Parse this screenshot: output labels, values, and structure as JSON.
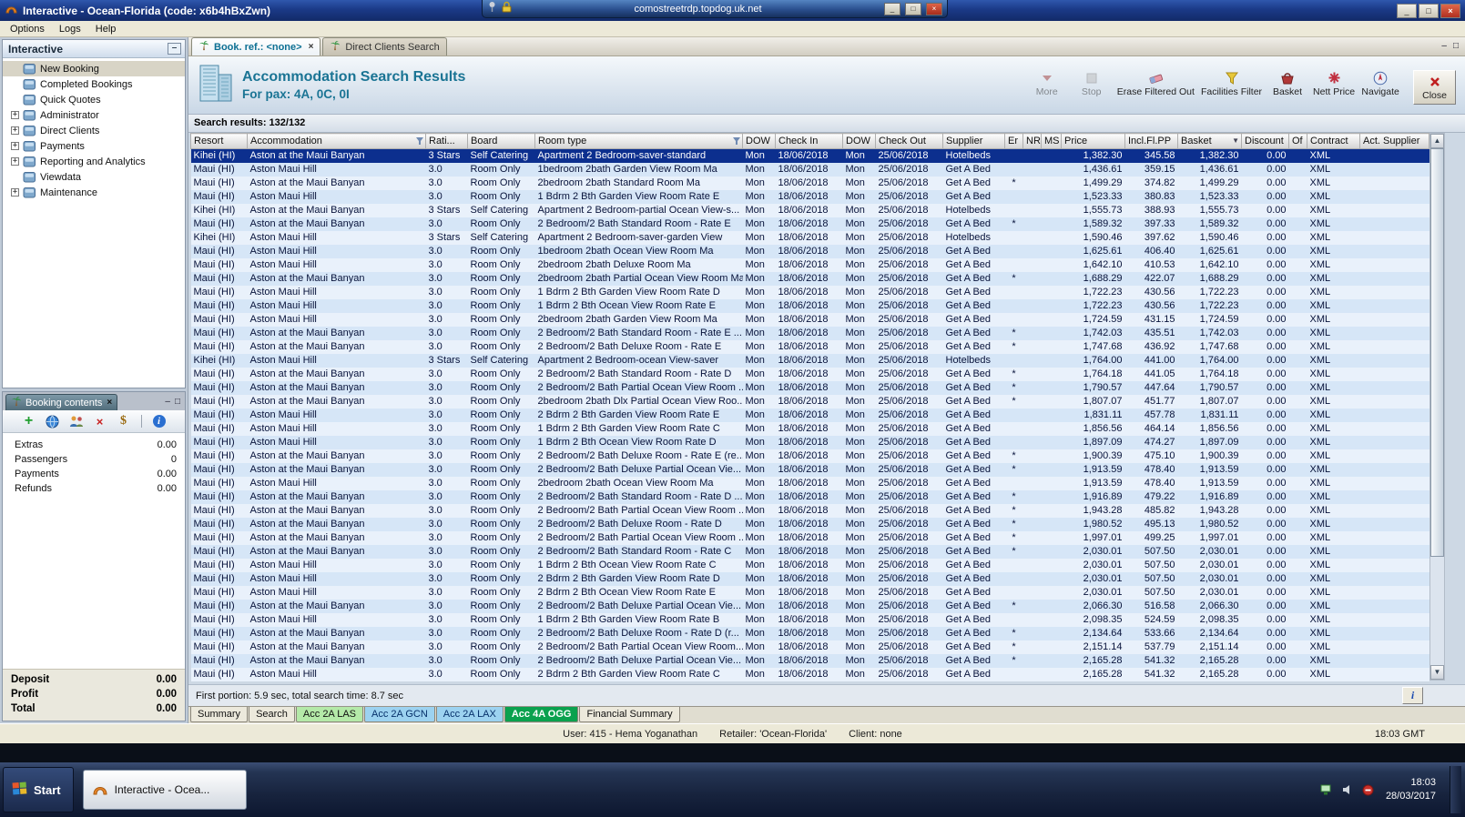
{
  "rdp_bar": {
    "host": "comostreetrdp.topdog.uk.net"
  },
  "window": {
    "title": "Interactive - Ocean-Florida (code: x6b4hBxZwn)"
  },
  "menu": {
    "items": [
      "Options",
      "Logs",
      "Help"
    ]
  },
  "sidebar": {
    "title": "Interactive",
    "items": [
      {
        "label": "New Booking",
        "expandable": false,
        "selected": true
      },
      {
        "label": "Completed Bookings",
        "expandable": false,
        "selected": false
      },
      {
        "label": "Quick Quotes",
        "expandable": false,
        "selected": false
      },
      {
        "label": "Administrator",
        "expandable": true,
        "selected": false
      },
      {
        "label": "Direct Clients",
        "expandable": true,
        "selected": false
      },
      {
        "label": "Payments",
        "expandable": true,
        "selected": false
      },
      {
        "label": "Reporting and Analytics",
        "expandable": true,
        "selected": false
      },
      {
        "label": "Viewdata",
        "expandable": false,
        "selected": false
      },
      {
        "label": "Maintenance",
        "expandable": true,
        "selected": false
      }
    ]
  },
  "booking_contents": {
    "title": "Booking contents",
    "rows": [
      {
        "label": "Extras",
        "value": "0.00"
      },
      {
        "label": "Passengers",
        "value": "0"
      },
      {
        "label": "Payments",
        "value": "0.00"
      },
      {
        "label": "Refunds",
        "value": "0.00"
      }
    ],
    "totals": [
      {
        "label": "Deposit",
        "value": "0.00"
      },
      {
        "label": "Profit",
        "value": "0.00"
      },
      {
        "label": "Total",
        "value": "0.00"
      }
    ]
  },
  "doc_tabs": [
    {
      "label": "Book. ref.: <none>",
      "active": true,
      "closable": true
    },
    {
      "label": "Direct Clients Search",
      "active": false,
      "closable": false
    }
  ],
  "header": {
    "title": "Accommodation Search Results",
    "subtitle": "For pax: 4A, 0C, 0I"
  },
  "toolbar": {
    "buttons": [
      {
        "label": "More",
        "icon": "more",
        "disabled": true,
        "raised": false
      },
      {
        "label": "Stop",
        "icon": "stop",
        "disabled": true,
        "raised": false
      },
      {
        "label": "Erase Filtered Out",
        "icon": "eraser",
        "disabled": false,
        "raised": false
      },
      {
        "label": "Facilities Filter",
        "icon": "filter",
        "disabled": false,
        "raised": false
      },
      {
        "label": "Basket",
        "icon": "basket",
        "disabled": false,
        "raised": false
      },
      {
        "label": "Nett Price",
        "icon": "nett",
        "disabled": false,
        "raised": false
      },
      {
        "label": "Navigate",
        "icon": "navigate",
        "disabled": false,
        "raised": false
      },
      {
        "label": "Close",
        "icon": "close",
        "disabled": false,
        "raised": true
      }
    ]
  },
  "results": {
    "summary_label": "Search results: 132/132",
    "columns": [
      {
        "label": "Resort"
      },
      {
        "label": "Accommodation",
        "filter": true
      },
      {
        "label": "Rati..."
      },
      {
        "label": "Board"
      },
      {
        "label": "Room type",
        "filter": true
      },
      {
        "label": "DOW"
      },
      {
        "label": "Check In"
      },
      {
        "label": "DOW"
      },
      {
        "label": "Check Out"
      },
      {
        "label": "Supplier"
      },
      {
        "label": "Er"
      },
      {
        "label": "NR"
      },
      {
        "label": "MS"
      },
      {
        "label": "Price"
      },
      {
        "label": "Incl.Fl.PP"
      },
      {
        "label": "Basket",
        "sort": true
      },
      {
        "label": "Discount"
      },
      {
        "label": "Of"
      },
      {
        "label": "Contract"
      },
      {
        "label": "Act. Supplier"
      }
    ],
    "row_defaults": {
      "dow": "Mon",
      "check_in": "18/06/2018",
      "check_out": "25/06/2018",
      "discount": "0.00",
      "contract": "XML"
    },
    "selected_row": 0,
    "rows": [
      [
        "Kihei (HI)",
        "Aston at the Maui Banyan",
        "3 Stars",
        "Self Catering",
        "Apartment 2 Bedroom-saver-standard",
        "Hotelbeds",
        "",
        "1,382.30",
        "345.58",
        "1,382.30"
      ],
      [
        "Maui (HI)",
        "Aston Maui Hill",
        "3.0",
        "Room Only",
        "1bedroom 2bath Garden View Room Ma",
        "Get A Bed",
        "",
        "1,436.61",
        "359.15",
        "1,436.61"
      ],
      [
        "Maui (HI)",
        "Aston at the Maui Banyan",
        "3.0",
        "Room Only",
        "2bedroom 2bath Standard Room Ma",
        "Get A Bed",
        "*",
        "1,499.29",
        "374.82",
        "1,499.29"
      ],
      [
        "Maui (HI)",
        "Aston Maui Hill",
        "3.0",
        "Room Only",
        "1 Bdrm 2 Bth Garden View Room Rate E",
        "Get A Bed",
        "",
        "1,523.33",
        "380.83",
        "1,523.33"
      ],
      [
        "Kihei (HI)",
        "Aston at the Maui Banyan",
        "3 Stars",
        "Self Catering",
        "Apartment 2 Bedroom-partial Ocean View-s...",
        "Hotelbeds",
        "",
        "1,555.73",
        "388.93",
        "1,555.73"
      ],
      [
        "Maui (HI)",
        "Aston at the Maui Banyan",
        "3.0",
        "Room Only",
        "2 Bedroom/2 Bath Standard Room - Rate E",
        "Get A Bed",
        "*",
        "1,589.32",
        "397.33",
        "1,589.32"
      ],
      [
        "Kihei (HI)",
        "Aston Maui Hill",
        "3 Stars",
        "Self Catering",
        "Apartment 2 Bedroom-saver-garden View",
        "Hotelbeds",
        "",
        "1,590.46",
        "397.62",
        "1,590.46"
      ],
      [
        "Maui (HI)",
        "Aston Maui Hill",
        "3.0",
        "Room Only",
        "1bedroom 2bath Ocean View Room Ma",
        "Get A Bed",
        "",
        "1,625.61",
        "406.40",
        "1,625.61"
      ],
      [
        "Maui (HI)",
        "Aston Maui Hill",
        "3.0",
        "Room Only",
        "2bedroom 2bath Deluxe Room Ma",
        "Get A Bed",
        "",
        "1,642.10",
        "410.53",
        "1,642.10"
      ],
      [
        "Maui (HI)",
        "Aston at the Maui Banyan",
        "3.0",
        "Room Only",
        "2bedroom 2bath Partial Ocean View Room Ma",
        "Get A Bed",
        "*",
        "1,688.29",
        "422.07",
        "1,688.29"
      ],
      [
        "Maui (HI)",
        "Aston Maui Hill",
        "3.0",
        "Room Only",
        "1 Bdrm 2 Bth Garden View Room Rate D",
        "Get A Bed",
        "",
        "1,722.23",
        "430.56",
        "1,722.23"
      ],
      [
        "Maui (HI)",
        "Aston Maui Hill",
        "3.0",
        "Room Only",
        "1 Bdrm 2 Bth Ocean View Room Rate E",
        "Get A Bed",
        "",
        "1,722.23",
        "430.56",
        "1,722.23"
      ],
      [
        "Maui (HI)",
        "Aston Maui Hill",
        "3.0",
        "Room Only",
        "2bedroom 2bath Garden View Room Ma",
        "Get A Bed",
        "",
        "1,724.59",
        "431.15",
        "1,724.59"
      ],
      [
        "Maui (HI)",
        "Aston at the Maui Banyan",
        "3.0",
        "Room Only",
        "2 Bedroom/2 Bath Standard Room - Rate E ...",
        "Get A Bed",
        "*",
        "1,742.03",
        "435.51",
        "1,742.03"
      ],
      [
        "Maui (HI)",
        "Aston at the Maui Banyan",
        "3.0",
        "Room Only",
        "2 Bedroom/2 Bath Deluxe Room - Rate E",
        "Get A Bed",
        "*",
        "1,747.68",
        "436.92",
        "1,747.68"
      ],
      [
        "Kihei (HI)",
        "Aston Maui Hill",
        "3 Stars",
        "Self Catering",
        "Apartment 2 Bedroom-ocean View-saver",
        "Hotelbeds",
        "",
        "1,764.00",
        "441.00",
        "1,764.00"
      ],
      [
        "Maui (HI)",
        "Aston at the Maui Banyan",
        "3.0",
        "Room Only",
        "2 Bedroom/2 Bath Standard Room - Rate D",
        "Get A Bed",
        "*",
        "1,764.18",
        "441.05",
        "1,764.18"
      ],
      [
        "Maui (HI)",
        "Aston at the Maui Banyan",
        "3.0",
        "Room Only",
        "2 Bedroom/2 Bath Partial Ocean View Room ...",
        "Get A Bed",
        "*",
        "1,790.57",
        "447.64",
        "1,790.57"
      ],
      [
        "Maui (HI)",
        "Aston at the Maui Banyan",
        "3.0",
        "Room Only",
        "2bedroom 2bath Dlx Partial Ocean View Roo...",
        "Get A Bed",
        "*",
        "1,807.07",
        "451.77",
        "1,807.07"
      ],
      [
        "Maui (HI)",
        "Aston Maui Hill",
        "3.0",
        "Room Only",
        "2 Bdrm 2 Bth Garden View Room Rate E",
        "Get A Bed",
        "",
        "1,831.11",
        "457.78",
        "1,831.11"
      ],
      [
        "Maui (HI)",
        "Aston Maui Hill",
        "3.0",
        "Room Only",
        "1 Bdrm 2 Bth Garden View Room Rate C",
        "Get A Bed",
        "",
        "1,856.56",
        "464.14",
        "1,856.56"
      ],
      [
        "Maui (HI)",
        "Aston Maui Hill",
        "3.0",
        "Room Only",
        "1 Bdrm 2 Bth Ocean View Room Rate D",
        "Get A Bed",
        "",
        "1,897.09",
        "474.27",
        "1,897.09"
      ],
      [
        "Maui (HI)",
        "Aston at the Maui Banyan",
        "3.0",
        "Room Only",
        "2 Bedroom/2 Bath Deluxe Room - Rate E (re...",
        "Get A Bed",
        "*",
        "1,900.39",
        "475.10",
        "1,900.39"
      ],
      [
        "Maui (HI)",
        "Aston at the Maui Banyan",
        "3.0",
        "Room Only",
        "2 Bedroom/2 Bath Deluxe Partial Ocean Vie...",
        "Get A Bed",
        "*",
        "1,913.59",
        "478.40",
        "1,913.59"
      ],
      [
        "Maui (HI)",
        "Aston Maui Hill",
        "3.0",
        "Room Only",
        "2bedroom 2bath Ocean View Room Ma",
        "Get A Bed",
        "",
        "1,913.59",
        "478.40",
        "1,913.59"
      ],
      [
        "Maui (HI)",
        "Aston at the Maui Banyan",
        "3.0",
        "Room Only",
        "2 Bedroom/2 Bath Standard Room - Rate D ...",
        "Get A Bed",
        "*",
        "1,916.89",
        "479.22",
        "1,916.89"
      ],
      [
        "Maui (HI)",
        "Aston at the Maui Banyan",
        "3.0",
        "Room Only",
        "2 Bedroom/2 Bath Partial Ocean View Room ...",
        "Get A Bed",
        "*",
        "1,943.28",
        "485.82",
        "1,943.28"
      ],
      [
        "Maui (HI)",
        "Aston at the Maui Banyan",
        "3.0",
        "Room Only",
        "2 Bedroom/2 Bath Deluxe Room - Rate D",
        "Get A Bed",
        "*",
        "1,980.52",
        "495.13",
        "1,980.52"
      ],
      [
        "Maui (HI)",
        "Aston at the Maui Banyan",
        "3.0",
        "Room Only",
        "2 Bedroom/2 Bath Partial Ocean View Room ...",
        "Get A Bed",
        "*",
        "1,997.01",
        "499.25",
        "1,997.01"
      ],
      [
        "Maui (HI)",
        "Aston at the Maui Banyan",
        "3.0",
        "Room Only",
        "2 Bedroom/2 Bath Standard Room - Rate C",
        "Get A Bed",
        "*",
        "2,030.01",
        "507.50",
        "2,030.01"
      ],
      [
        "Maui (HI)",
        "Aston Maui Hill",
        "3.0",
        "Room Only",
        "1 Bdrm 2 Bth Ocean View Room Rate C",
        "Get A Bed",
        "",
        "2,030.01",
        "507.50",
        "2,030.01"
      ],
      [
        "Maui (HI)",
        "Aston Maui Hill",
        "3.0",
        "Room Only",
        "2 Bdrm 2 Bth Garden View Room Rate D",
        "Get A Bed",
        "",
        "2,030.01",
        "507.50",
        "2,030.01"
      ],
      [
        "Maui (HI)",
        "Aston Maui Hill",
        "3.0",
        "Room Only",
        "2 Bdrm 2 Bth Ocean View Room Rate E",
        "Get A Bed",
        "",
        "2,030.01",
        "507.50",
        "2,030.01"
      ],
      [
        "Maui (HI)",
        "Aston at the Maui Banyan",
        "3.0",
        "Room Only",
        "2 Bedroom/2 Bath Deluxe Partial Ocean Vie...",
        "Get A Bed",
        "*",
        "2,066.30",
        "516.58",
        "2,066.30"
      ],
      [
        "Maui (HI)",
        "Aston Maui Hill",
        "3.0",
        "Room Only",
        "1 Bdrm 2 Bth Garden View Room Rate B",
        "Get A Bed",
        "",
        "2,098.35",
        "524.59",
        "2,098.35"
      ],
      [
        "Maui (HI)",
        "Aston at the Maui Banyan",
        "3.0",
        "Room Only",
        "2 Bedroom/2 Bath Deluxe Room - Rate D (r...",
        "Get A Bed",
        "*",
        "2,134.64",
        "533.66",
        "2,134.64"
      ],
      [
        "Maui (HI)",
        "Aston at the Maui Banyan",
        "3.0",
        "Room Only",
        "2 Bedroom/2 Bath Partial Ocean View Room...",
        "Get A Bed",
        "*",
        "2,151.14",
        "537.79",
        "2,151.14"
      ],
      [
        "Maui (HI)",
        "Aston at the Maui Banyan",
        "3.0",
        "Room Only",
        "2 Bedroom/2 Bath Deluxe Partial Ocean Vie...",
        "Get A Bed",
        "*",
        "2,165.28",
        "541.32",
        "2,165.28"
      ],
      [
        "Maui (HI)",
        "Aston Maui Hill",
        "3.0",
        "Room Only",
        "2 Bdrm 2 Bth Garden View Room Rate C",
        "Get A Bed",
        "",
        "2,165.28",
        "541.32",
        "2,165.28"
      ]
    ]
  },
  "status": {
    "portion": "First portion: 5.9 sec, total search time: 8.7 sec",
    "info_label": "i"
  },
  "bottom_tabs": [
    {
      "label": "Summary",
      "style": "plain",
      "selected": false
    },
    {
      "label": "Search",
      "style": "plain",
      "selected": false
    },
    {
      "label": "Acc 2A LAS",
      "style": "green",
      "selected": false
    },
    {
      "label": "Acc 2A GCN",
      "style": "blue",
      "selected": false
    },
    {
      "label": "Acc 2A LAX",
      "style": "blue",
      "selected": false
    },
    {
      "label": "Acc 4A OGG",
      "style": "dark-green",
      "selected": true
    },
    {
      "label": "Financial Summary",
      "style": "plain",
      "selected": false
    }
  ],
  "statusbar": {
    "user": "User: 415 - Hema Yoganathan",
    "retailer": "Retailer: 'Ocean-Florida'",
    "client": "Client: none",
    "time": "18:03 GMT"
  },
  "taskbar": {
    "start_label": "Start",
    "task_label": "Interactive - Ocea...",
    "clock_time": "18:03",
    "clock_date": "28/03/2017"
  }
}
